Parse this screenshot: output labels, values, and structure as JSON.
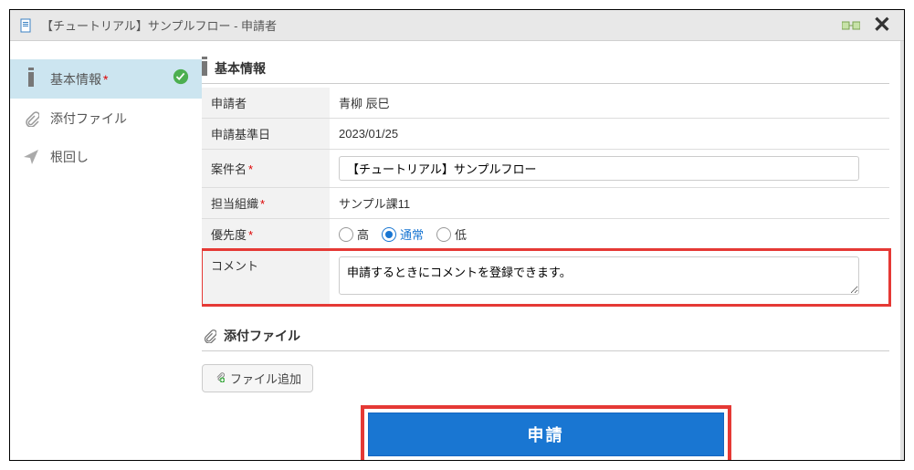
{
  "titlebar": {
    "title": "【チュートリアル】サンプルフロー - 申請者"
  },
  "sidebar": {
    "items": [
      {
        "label": "基本情報",
        "required": true,
        "active": true,
        "complete": true
      },
      {
        "label": "添付ファイル",
        "required": false,
        "active": false,
        "complete": false
      },
      {
        "label": "根回し",
        "required": false,
        "active": false,
        "complete": false
      }
    ]
  },
  "basic_info": {
    "heading": "基本情報",
    "applicant_label": "申請者",
    "applicant_value": "青柳 辰巳",
    "base_date_label": "申請基準日",
    "base_date_value": "2023/01/25",
    "subject_label": "案件名",
    "subject_value": "【チュートリアル】サンプルフロー",
    "org_label": "担当組織",
    "org_value": "サンプル課11",
    "priority_label": "優先度",
    "priority_options": [
      {
        "label": "高",
        "selected": false
      },
      {
        "label": "通常",
        "selected": true
      },
      {
        "label": "低",
        "selected": false
      }
    ],
    "comment_label": "コメント",
    "comment_value": "申請するときにコメントを登録できます。"
  },
  "attach": {
    "heading": "添付ファイル",
    "add_btn": "ファイル追加"
  },
  "submit_label": "申請"
}
